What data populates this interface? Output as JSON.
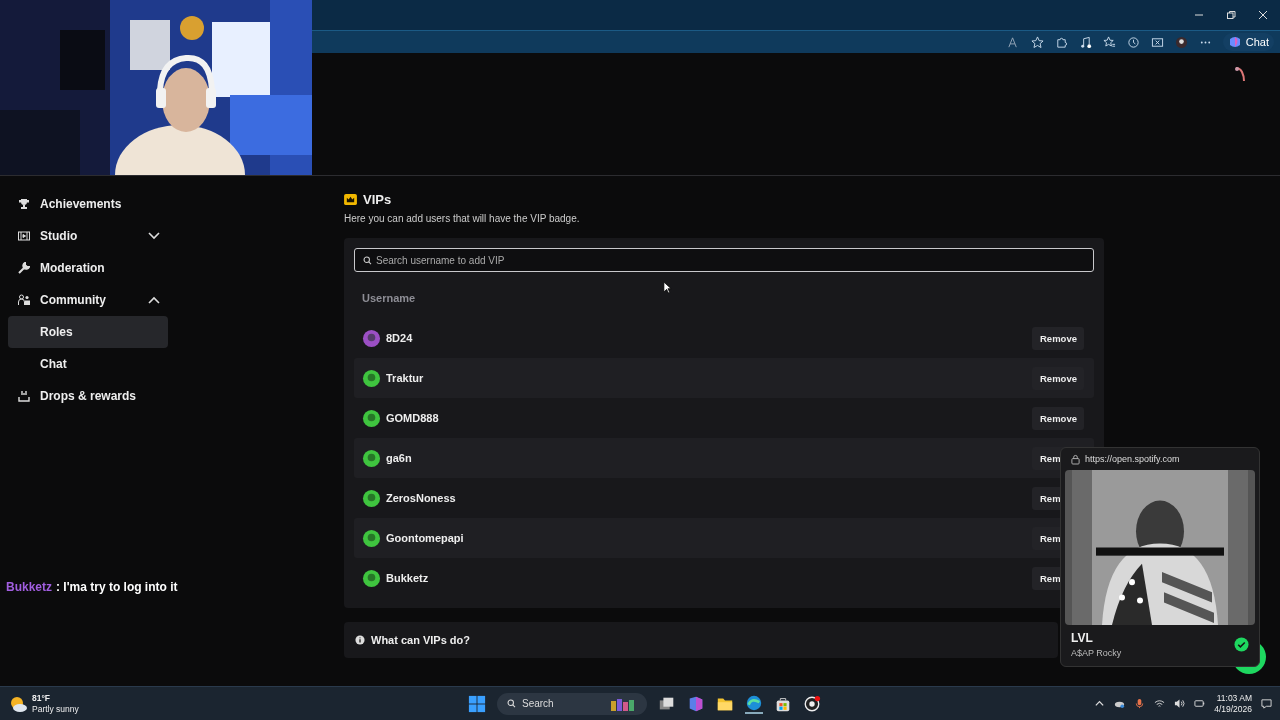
{
  "browser": {
    "chat_button": "Chat"
  },
  "sidebar": {
    "items": [
      {
        "label": "Achievements",
        "selected": false
      },
      {
        "label": "Studio",
        "selected": false,
        "expanded": false
      },
      {
        "label": "Moderation",
        "selected": false
      },
      {
        "label": "Community",
        "selected": false,
        "expanded": true,
        "children": [
          {
            "label": "Roles",
            "selected": true
          },
          {
            "label": "Chat",
            "selected": false
          }
        ]
      },
      {
        "label": "Drops & rewards",
        "selected": false
      }
    ]
  },
  "vips": {
    "title": "VIPs",
    "description": "Here you can add users that will have the VIP badge.",
    "search": {
      "placeholder": "Search username to add VIP"
    },
    "column": "Username",
    "rows": [
      {
        "username": "8D24",
        "action": "Remove",
        "color": "#9b4fc4"
      },
      {
        "username": "Traktur",
        "action": "Remove",
        "color": "#3fc43f"
      },
      {
        "username": "GOMD888",
        "action": "Remove",
        "color": "#3fc43f"
      },
      {
        "username": "ga6n",
        "action": "Rem",
        "color": "#3fc43f"
      },
      {
        "username": "ZerosNoness",
        "action": "Rem",
        "color": "#3fc43f"
      },
      {
        "username": "Goontomepapi",
        "action": "Rem",
        "color": "#3fc43f"
      },
      {
        "username": "Bukketz",
        "action": "Rem",
        "color": "#3fc43f"
      }
    ]
  },
  "info": {
    "title": "What can VIPs do?"
  },
  "stream_chat": {
    "user": "Bukketz",
    "message": ": I'ma try to log into it"
  },
  "media_popup": {
    "url": "https://open.spotify.com",
    "track": "LVL",
    "artist": "A$AP Rocky",
    "saved": true
  },
  "taskbar": {
    "weather": {
      "temperature": "81°F",
      "condition": "Partly sunny"
    },
    "search": {
      "placeholder": "Search"
    },
    "time": "11:03 AM",
    "date": "4/19/2026"
  }
}
